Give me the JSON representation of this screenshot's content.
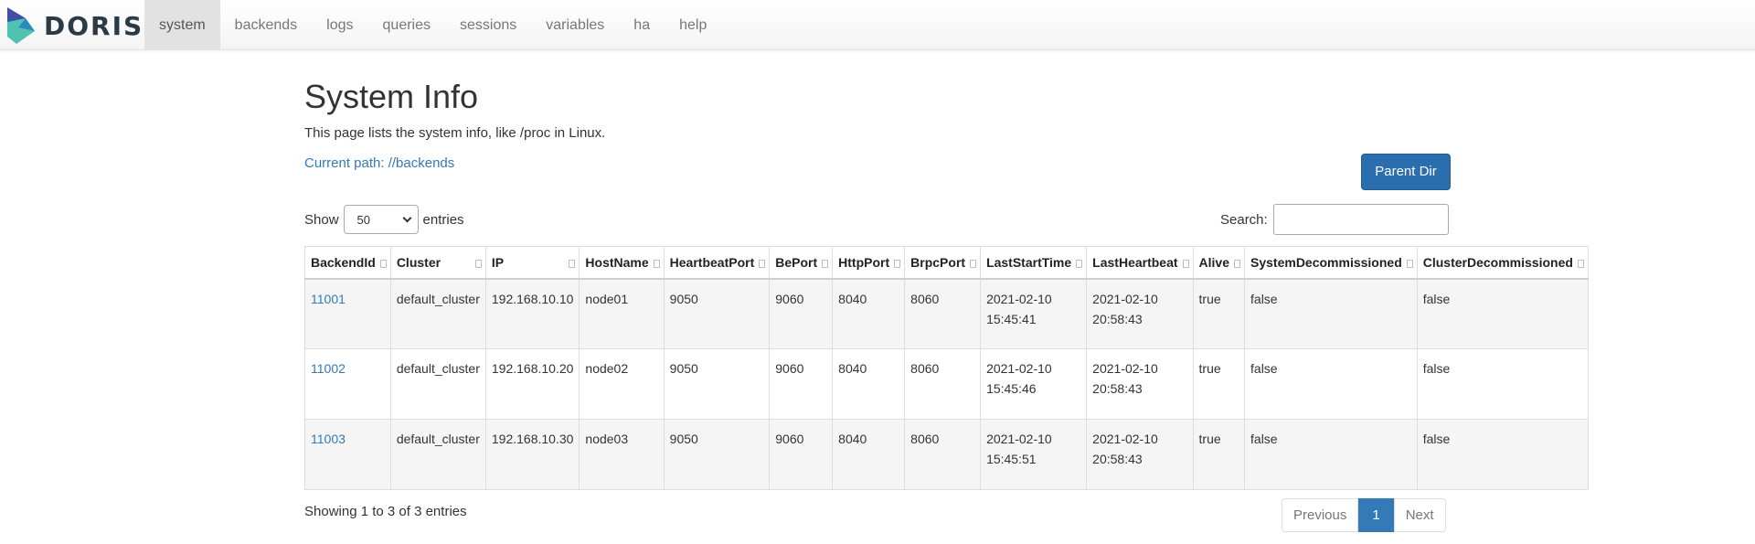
{
  "brand": {
    "name": "DORIS"
  },
  "nav": {
    "items": [
      {
        "label": "system",
        "active": true
      },
      {
        "label": "backends",
        "active": false
      },
      {
        "label": "logs",
        "active": false
      },
      {
        "label": "queries",
        "active": false
      },
      {
        "label": "sessions",
        "active": false
      },
      {
        "label": "variables",
        "active": false
      },
      {
        "label": "ha",
        "active": false
      },
      {
        "label": "help",
        "active": false
      }
    ]
  },
  "page": {
    "title": "System Info",
    "description": "This page lists the system info, like /proc in Linux.",
    "current_path": "Current path: //backends",
    "parent_button": "Parent Dir"
  },
  "controls": {
    "show_label": "Show",
    "entries_value": "50",
    "entries_label": "entries",
    "search_label": "Search:",
    "search_value": ""
  },
  "table": {
    "columns": [
      "BackendId",
      "Cluster",
      "IP",
      "HostName",
      "HeartbeatPort",
      "BePort",
      "HttpPort",
      "BrpcPort",
      "LastStartTime",
      "LastHeartbeat",
      "Alive",
      "SystemDecommissioned",
      "ClusterDecommissioned"
    ],
    "rows": [
      {
        "BackendId": "11001",
        "Cluster": "default_cluster",
        "IP": "192.168.10.10",
        "HostName": "node01",
        "HeartbeatPort": "9050",
        "BePort": "9060",
        "HttpPort": "8040",
        "BrpcPort": "8060",
        "LastStartTime": [
          "2021-02-10",
          "15:45:41"
        ],
        "LastHeartbeat": [
          "2021-02-10",
          "20:58:43"
        ],
        "Alive": "true",
        "SystemDecommissioned": "false",
        "ClusterDecommissioned": "false"
      },
      {
        "BackendId": "11002",
        "Cluster": "default_cluster",
        "IP": "192.168.10.20",
        "HostName": "node02",
        "HeartbeatPort": "9050",
        "BePort": "9060",
        "HttpPort": "8040",
        "BrpcPort": "8060",
        "LastStartTime": [
          "2021-02-10",
          "15:45:46"
        ],
        "LastHeartbeat": [
          "2021-02-10",
          "20:58:43"
        ],
        "Alive": "true",
        "SystemDecommissioned": "false",
        "ClusterDecommissioned": "false"
      },
      {
        "BackendId": "11003",
        "Cluster": "default_cluster",
        "IP": "192.168.10.30",
        "HostName": "node03",
        "HeartbeatPort": "9050",
        "BePort": "9060",
        "HttpPort": "8040",
        "BrpcPort": "8060",
        "LastStartTime": [
          "2021-02-10",
          "15:45:51"
        ],
        "LastHeartbeat": [
          "2021-02-10",
          "20:58:43"
        ],
        "Alive": "true",
        "SystemDecommissioned": "false",
        "ClusterDecommissioned": "false"
      }
    ]
  },
  "footer": {
    "info": "Showing 1 to 3 of 3 entries",
    "pagination": {
      "previous": "Previous",
      "current": "1",
      "next": "Next"
    }
  },
  "colors": {
    "link": "#337ab7",
    "primary_button": "#2a6eb0",
    "logo_dark": "#3d4fa8",
    "logo_teal": "#4fc3b0"
  }
}
